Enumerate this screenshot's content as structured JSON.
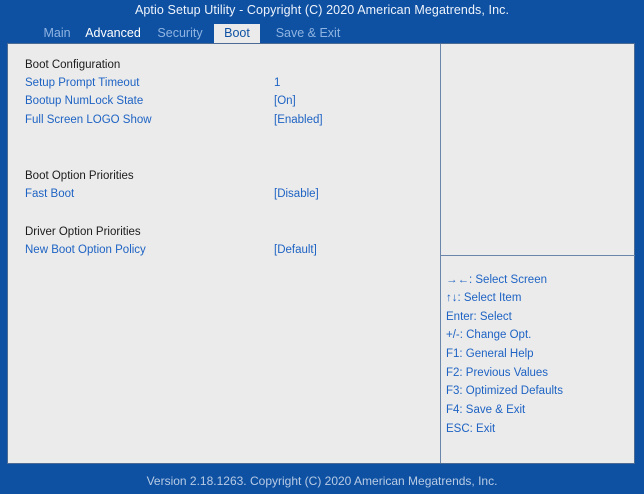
{
  "title": "Aptio Setup Utility - Copyright (C) 2020 American Megatrends, Inc.",
  "tabs": [
    "Main",
    "Advanced",
    "Security",
    "Boot",
    "Save & Exit"
  ],
  "active_tab": "Boot",
  "sections": {
    "boot_configuration": "Boot Configuration",
    "boot_option_priorities": "Boot Option Priorities",
    "driver_option_priorities": "Driver Option Priorities"
  },
  "settings": [
    {
      "label": "Setup Prompt Timeout",
      "value": "1"
    },
    {
      "label": "Bootup NumLock State",
      "value": "[On]"
    },
    {
      "label": "Full Screen LOGO Show",
      "value": "[Enabled]"
    },
    {
      "label": "Fast Boot",
      "value": "[Disable]"
    },
    {
      "label": "New Boot Option Policy",
      "value": "[Default]"
    }
  ],
  "help": [
    "→←: Select Screen",
    "↑↓: Select Item",
    "Enter: Select",
    "+/-: Change Opt.",
    "F1: General Help",
    "F2: Previous Values",
    "F3: Optimized Defaults",
    "F4: Save & Exit",
    "ESC: Exit"
  ],
  "footer": "Version 2.18.1263. Copyright (C) 2020 American Megatrends, Inc.",
  "colors": {
    "background": "#0e51a3",
    "panel": "#ebebeb",
    "item_text": "#1e63c4",
    "active_tab_text": "#0e51a3"
  }
}
